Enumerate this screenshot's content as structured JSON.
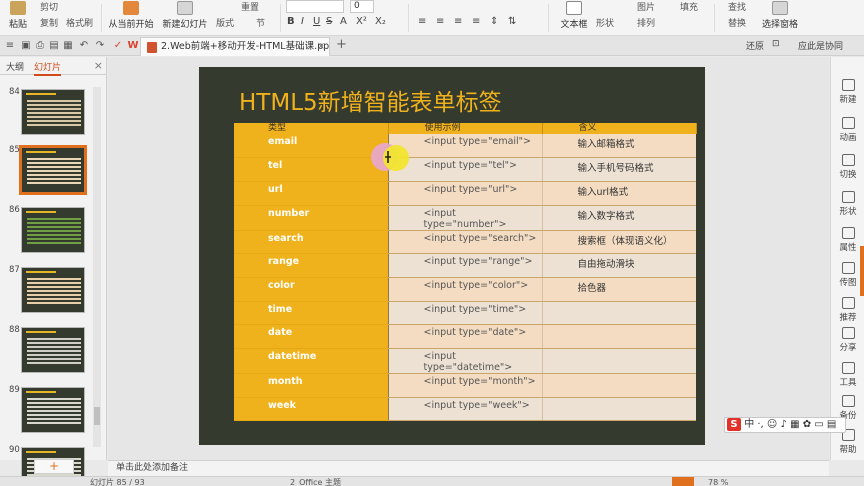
{
  "ribbon": {
    "paste": "粘贴",
    "cut": "剪切",
    "copy": "复制",
    "format_painter": "格式刷",
    "play_from_current": "从当前开始",
    "new_slide": "新建幻灯片",
    "layout": "版式",
    "section": "节",
    "reset": "重置",
    "font_size": "0",
    "textbox": "文本框",
    "shape": "形状",
    "arrange": "排列",
    "picture": "图片",
    "fill": "填充",
    "find": "查找",
    "replace": "替换",
    "select_pane": "选择窗格",
    "format_bold": "B",
    "format_italic": "I",
    "format_underline": "U",
    "format_strike": "S",
    "format_shadow": "A",
    "format_sup": "X²",
    "format_sub": "X₂"
  },
  "tabbar": {
    "doc_tab": "2.Web前端+移动开发-HTML基础课.ppt *",
    "add_tab": "+",
    "restore_label": "还原",
    "collab": "应此是协同"
  },
  "leftpanel": {
    "tab_outline": "大纲",
    "tab_slides": "幻灯片",
    "close": "×",
    "add": "+",
    "thumbs": [
      {
        "num": "84",
        "grid": "#d9c8a6"
      },
      {
        "num": "85",
        "grid": "#e8d6b4"
      },
      {
        "num": "86",
        "grid": "#6fa046"
      },
      {
        "num": "87",
        "grid": "#e9cfa8"
      },
      {
        "num": "88",
        "grid": "#cfcfc7"
      },
      {
        "num": "89",
        "grid": "#d8d8cf"
      },
      {
        "num": "90",
        "grid": "#d8d8cf"
      }
    ]
  },
  "slide": {
    "title": "HTML5新增智能表单标签",
    "headers": [
      "类型",
      "使用示例",
      "含义"
    ],
    "rows": [
      [
        "email",
        "<input type=\"email\">",
        "输入邮箱格式"
      ],
      [
        "tel",
        "<input type=\"tel\">",
        "输入手机号码格式"
      ],
      [
        "url",
        "<input type=\"url\">",
        "输入url格式"
      ],
      [
        "number",
        "<input type=\"number\">",
        "输入数字格式"
      ],
      [
        "search",
        "<input type=\"search\">",
        "搜索框（体现语义化）"
      ],
      [
        "range",
        "<input type=\"range\">",
        "自由拖动滑块"
      ],
      [
        "color",
        "<input type=\"color\">",
        "拾色器"
      ],
      [
        "time",
        "<input type=\"time\">",
        ""
      ],
      [
        "date",
        "<input type=\"date\">",
        ""
      ],
      [
        "datetime",
        "<input type=\"datetime\">",
        ""
      ],
      [
        "month",
        "<input type=\"month\">",
        ""
      ],
      [
        "week",
        "<input type=\"week\">",
        ""
      ]
    ]
  },
  "rightbar": {
    "items": [
      "新建",
      "动画",
      "切换",
      "形状",
      "属性",
      "传图",
      "推荐",
      "分享",
      "工具",
      "备份",
      "帮助"
    ]
  },
  "ime": {
    "logo": "S",
    "mode": "中",
    "rest": "·, ☺ ♪ ▦ ✿ ▭ ▤"
  },
  "notes": {
    "placeholder": "单击此处添加备注"
  },
  "status": {
    "slide_info": "幻灯片 85 / 93",
    "theme": "2_Office 主题",
    "zoom": "78 %"
  },
  "colors": {
    "accent": "#e0701e",
    "slide_bg": "#343a2e",
    "gold": "#f0b21c"
  }
}
